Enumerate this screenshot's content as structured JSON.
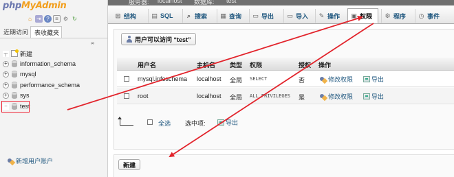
{
  "app": {
    "logo_part1": "php",
    "logo_part2": "MyAdmin"
  },
  "nav": {
    "icons": [
      "home-icon",
      "exit-icon",
      "help-icon",
      "docs-icon",
      "settings-icon",
      "reload-icon"
    ],
    "tabs": [
      {
        "label": "近期访问",
        "active": false
      },
      {
        "label": "表收藏夹",
        "active": true
      }
    ],
    "collapse_label": "∞",
    "tree": [
      {
        "label": "新建",
        "type": "new"
      },
      {
        "label": "information_schema",
        "type": "db"
      },
      {
        "label": "mysql",
        "type": "db"
      },
      {
        "label": "performance_schema",
        "type": "db"
      },
      {
        "label": "sys",
        "type": "db"
      },
      {
        "label": "test",
        "type": "db",
        "highlighted": true
      }
    ]
  },
  "breadcrumb": {
    "server_label": "服务器:",
    "server": "localhost",
    "db_label": "数据库:",
    "db": "test"
  },
  "menu": {
    "tabs": [
      {
        "label": "结构",
        "icon": "structure-icon"
      },
      {
        "label": "SQL",
        "icon": "sql-icon"
      },
      {
        "label": "搜索",
        "icon": "search-icon"
      },
      {
        "label": "查询",
        "icon": "query-icon"
      },
      {
        "label": "导出",
        "icon": "export-icon"
      },
      {
        "label": "导入",
        "icon": "import-icon"
      },
      {
        "label": "操作",
        "icon": "operations-icon"
      },
      {
        "label": "权限",
        "icon": "privileges-icon",
        "active": true
      },
      {
        "label": "程序",
        "icon": "routines-icon"
      },
      {
        "label": "事件",
        "icon": "events-icon"
      }
    ]
  },
  "privileges": {
    "legend": "用户可以访问 “test”",
    "columns": [
      "用户名",
      "主机名",
      "类型",
      "权限",
      "授权",
      "操作"
    ],
    "rows": [
      {
        "user": "mysql.infoschema",
        "host": "localhost",
        "type": "全局",
        "privileges": "SELECT",
        "grant": "否",
        "edit_label": "修改权限",
        "export_label": "导出"
      },
      {
        "user": "root",
        "host": "localhost",
        "type": "全局",
        "privileges": "ALL PRIVILEGES",
        "grant": "是",
        "edit_label": "修改权限",
        "export_label": "导出"
      }
    ],
    "select_all_label": "全选",
    "with_selected_label": "选中项:",
    "export_selected_label": "导出"
  },
  "new_section": {
    "legend": "新建",
    "add_user_label": "新增用户账户"
  },
  "colors": {
    "link": "#235a81",
    "annotation": "#e2232b",
    "logo_blue": "#6c78af",
    "logo_orange": "#f29f1e"
  }
}
